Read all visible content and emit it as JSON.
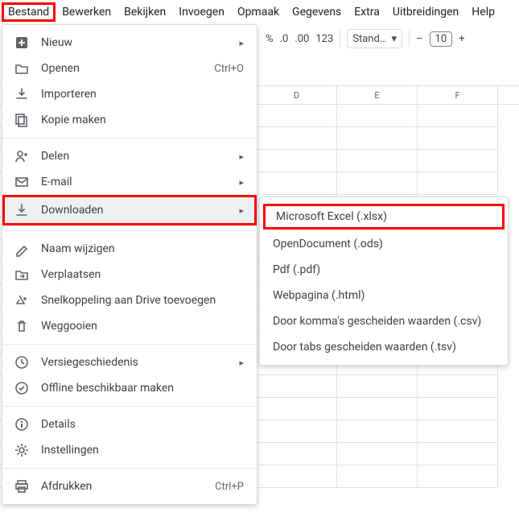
{
  "menubar": {
    "items": [
      "Bestand",
      "Bewerken",
      "Bekijken",
      "Invoegen",
      "Opmaak",
      "Gegevens",
      "Extra",
      "Uitbreidingen",
      "Help"
    ],
    "active_index": 0
  },
  "toolbar": {
    "percent": "%",
    "dec_dec": ".0",
    "dec_inc": ".00",
    "num_fmt": "123",
    "font": "Stand…",
    "minus": "–",
    "size": "10",
    "plus": "+"
  },
  "columns": [
    "D",
    "E",
    "F"
  ],
  "menu": [
    {
      "icon": "plus-box",
      "label": "Nieuw",
      "arrow": true
    },
    {
      "icon": "folder-open",
      "label": "Openen",
      "shortcut": "Ctrl+O"
    },
    {
      "icon": "import",
      "label": "Importeren"
    },
    {
      "icon": "copy",
      "label": "Kopie maken"
    },
    {
      "divider": true
    },
    {
      "icon": "person-plus",
      "label": "Delen",
      "arrow": true
    },
    {
      "icon": "mail",
      "label": "E-mail",
      "arrow": true
    },
    {
      "icon": "download",
      "label": "Downloaden",
      "arrow": true,
      "highlight": true
    },
    {
      "divider": true
    },
    {
      "icon": "pencil",
      "label": "Naam wijzigen"
    },
    {
      "icon": "folder-move",
      "label": "Verplaatsen"
    },
    {
      "icon": "drive-add",
      "label": "Snelkoppeling aan Drive toevoegen"
    },
    {
      "icon": "trash",
      "label": "Weggooien"
    },
    {
      "divider": true
    },
    {
      "icon": "history",
      "label": "Versiegeschiedenis",
      "arrow": true
    },
    {
      "icon": "offline",
      "label": "Offline beschikbaar maken"
    },
    {
      "divider": true
    },
    {
      "icon": "info",
      "label": "Details"
    },
    {
      "icon": "gear",
      "label": "Instellingen"
    },
    {
      "divider": true
    },
    {
      "icon": "print",
      "label": "Afdrukken",
      "shortcut": "Ctrl+P"
    }
  ],
  "submenu": [
    {
      "label": "Microsoft Excel (.xlsx)",
      "boxed": true
    },
    {
      "label": "OpenDocument (.ods)"
    },
    {
      "label": "Pdf (.pdf)"
    },
    {
      "label": "Webpagina (.html)"
    },
    {
      "label": "Door komma's gescheiden waarden (.csv)"
    },
    {
      "label": "Door tabs gescheiden waarden (.tsv)"
    }
  ]
}
